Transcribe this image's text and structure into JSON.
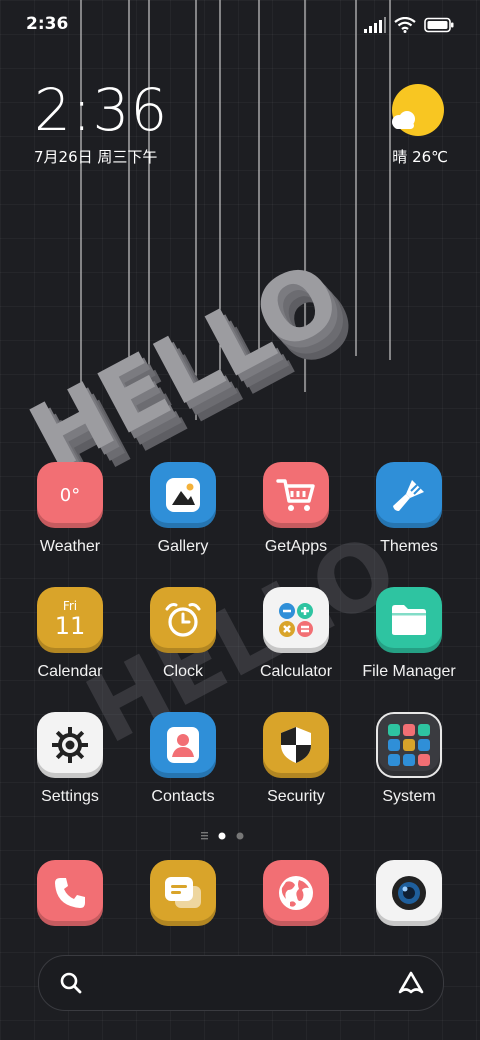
{
  "status_bar": {
    "time": "2:36"
  },
  "clock_widget": {
    "time": "2:36",
    "date": "7月26日 周三下午"
  },
  "weather_widget": {
    "condition": "晴",
    "temperature": "26℃"
  },
  "apps": [
    {
      "label": "Weather",
      "icon": "weather-icon",
      "icon_text": "0°",
      "color": "#f26f74"
    },
    {
      "label": "Gallery",
      "icon": "gallery-icon",
      "color": "#2f8fd8"
    },
    {
      "label": "GetApps",
      "icon": "cart-icon",
      "color": "#f26f74"
    },
    {
      "label": "Themes",
      "icon": "brush-icon",
      "color": "#2f8fd8"
    },
    {
      "label": "Calendar",
      "icon": "calendar-icon",
      "icon_day": "Fri",
      "icon_date": "11",
      "color": "#d9a42a"
    },
    {
      "label": "Clock",
      "icon": "alarm-clock-icon",
      "color": "#d9a42a"
    },
    {
      "label": "Calculator",
      "icon": "calculator-icon",
      "color": "#f3f3f3"
    },
    {
      "label": "File Manager",
      "icon": "folder-icon",
      "color": "#2ec4a1"
    },
    {
      "label": "Settings",
      "icon": "gear-icon",
      "color": "#f3f3f3"
    },
    {
      "label": "Contacts",
      "icon": "contact-icon",
      "color": "#2f8fd8"
    },
    {
      "label": "Security",
      "icon": "shield-icon",
      "color": "#d9a42a"
    },
    {
      "label": "System",
      "icon": "folder-grid-icon",
      "color": "#e8e8e8"
    }
  ],
  "dock": [
    {
      "icon": "phone-icon",
      "color": "#f26f74"
    },
    {
      "icon": "message-icon",
      "color": "#d9a42a"
    },
    {
      "icon": "browser-globe-icon",
      "color": "#f26f74"
    },
    {
      "icon": "camera-icon",
      "color": "#f3f3f3"
    }
  ],
  "page_indicator": {
    "current_page": 1,
    "total_pages": 2
  },
  "wallpaper": {
    "text": "HELLO"
  }
}
